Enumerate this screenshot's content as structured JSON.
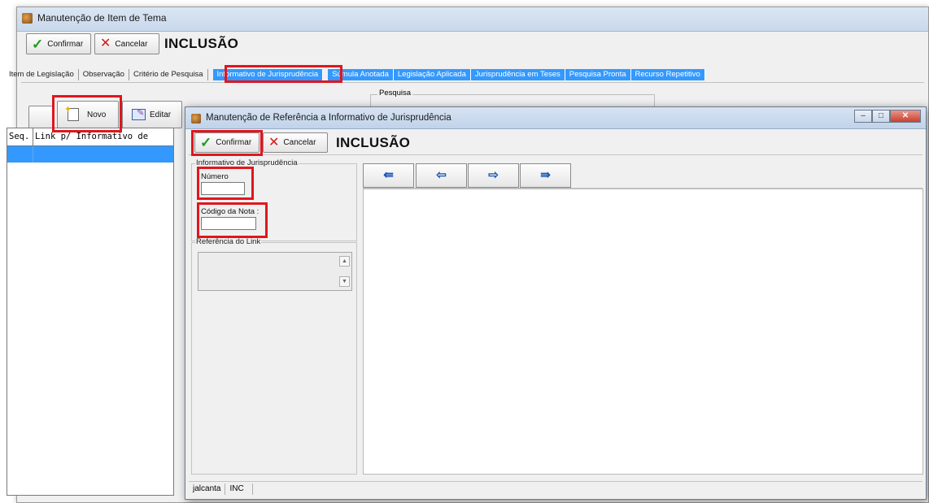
{
  "outer_window": {
    "title": "Manutenção de Item de Tema",
    "toolbar": {
      "confirm_label": "Confirmar",
      "cancel_label": "Cancelar",
      "mode": "INCLUSÃO"
    },
    "tabs": [
      {
        "label": "Item de Legislação",
        "active": false
      },
      {
        "label": "Observação",
        "active": false
      },
      {
        "label": "Critério de Pesquisa",
        "active": false
      },
      {
        "label": "Informativo de Jurisprudência",
        "active": true
      },
      {
        "label": "Súmula Anotada",
        "active": false
      },
      {
        "label": "Legislação Aplicada",
        "active": false
      },
      {
        "label": "Jurisprudência em Teses",
        "active": false
      },
      {
        "label": "Pesquisa Pronta",
        "active": false
      },
      {
        "label": "Recurso Repetitivo",
        "active": false
      }
    ],
    "actions": {
      "new_label": "Novo",
      "edit_label": "Editar"
    },
    "search_group_label": "Pesquisa",
    "grid": {
      "columns": [
        "Seq.",
        "Link p/ Informativo de"
      ]
    }
  },
  "inner_window": {
    "title": "Manutenção de Referência a Informativo de Jurisprudência",
    "toolbar": {
      "confirm_label": "Confirmar",
      "cancel_label": "Cancelar",
      "mode": "INCLUSÃO"
    },
    "group_informativo": {
      "legend": "Informativo de Jurisprudência",
      "numero_label": "Número",
      "numero_value": "",
      "codigo_label": "Código da Nota :",
      "codigo_value": ""
    },
    "group_referencia": {
      "legend": "Referência do Link"
    },
    "nav_buttons": [
      "first",
      "previous",
      "next",
      "last"
    ],
    "status_bar": {
      "user": "jalcanta",
      "mode": "INC"
    }
  },
  "colors": {
    "highlight": "#e0161e",
    "selected_tab": "#3399ff",
    "nav_arrow": "#1d55b7"
  }
}
